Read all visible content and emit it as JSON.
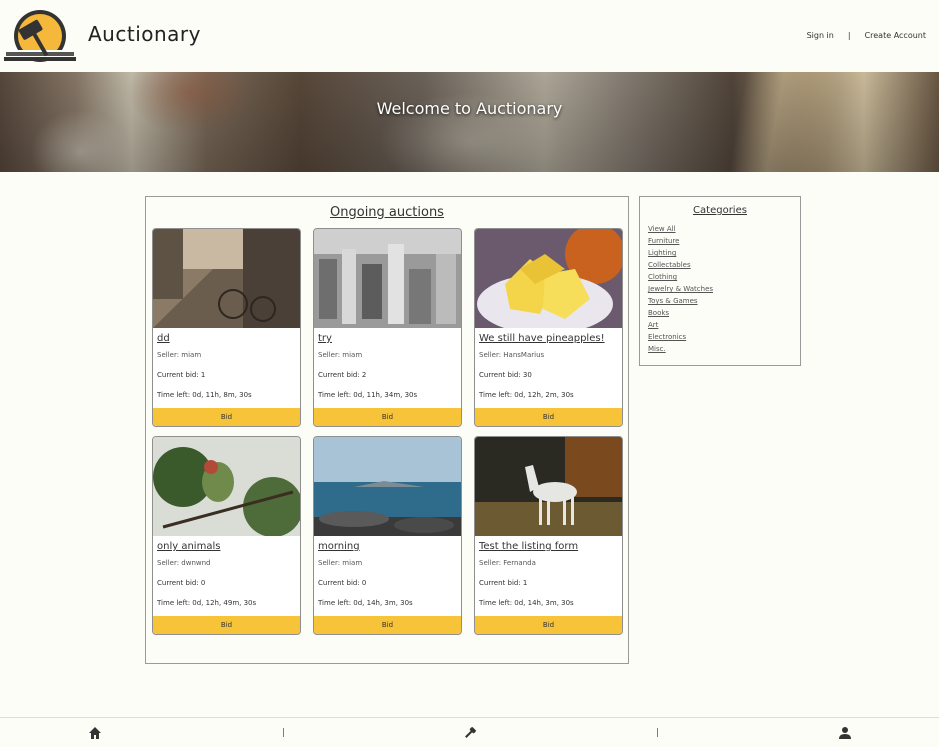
{
  "header": {
    "brand": "Auctionary",
    "sign_in": "Sign in",
    "separator": "|",
    "create_account": "Create Account"
  },
  "banner": {
    "title": "Welcome to Auctionary"
  },
  "auctions": {
    "title": "Ongoing auctions",
    "bid_label": "Bid",
    "items": [
      {
        "title": "dd",
        "seller": "Seller: miam",
        "current_bid": "Current bid: 1",
        "time_left": "Time left: 0d, 11h, 8m, 30s"
      },
      {
        "title": "try",
        "seller": "Seller: miam",
        "current_bid": "Current bid: 2",
        "time_left": "Time left: 0d, 11h, 34m, 30s"
      },
      {
        "title": "We still have pineapples!",
        "seller": "Seller: HansMarius",
        "current_bid": "Current bid: 30",
        "time_left": "Time left: 0d, 12h, 2m, 30s"
      },
      {
        "title": "only animals",
        "seller": "Seller: dwnwnd",
        "current_bid": "Current bid: 0",
        "time_left": "Time left: 0d, 12h, 49m, 30s"
      },
      {
        "title": "morning",
        "seller": "Seller: miam",
        "current_bid": "Current bid: 0",
        "time_left": "Time left: 0d, 14h, 3m, 30s"
      },
      {
        "title": "Test the listing form",
        "seller": "Seller: Fernanda",
        "current_bid": "Current bid: 1",
        "time_left": "Time left: 0d, 14h, 3m, 30s"
      }
    ]
  },
  "categories": {
    "title": "Categories",
    "items": [
      "View All",
      "Furniture",
      "Lighting",
      "Collectables",
      "Clothing",
      "Jewelry & Watches",
      "Toys & Games",
      "Books",
      "Art",
      "Electronics",
      "Misc."
    ]
  },
  "footer": {
    "separator": "|"
  },
  "colors": {
    "accent": "#f7c338",
    "background": "#fbfdf6"
  }
}
